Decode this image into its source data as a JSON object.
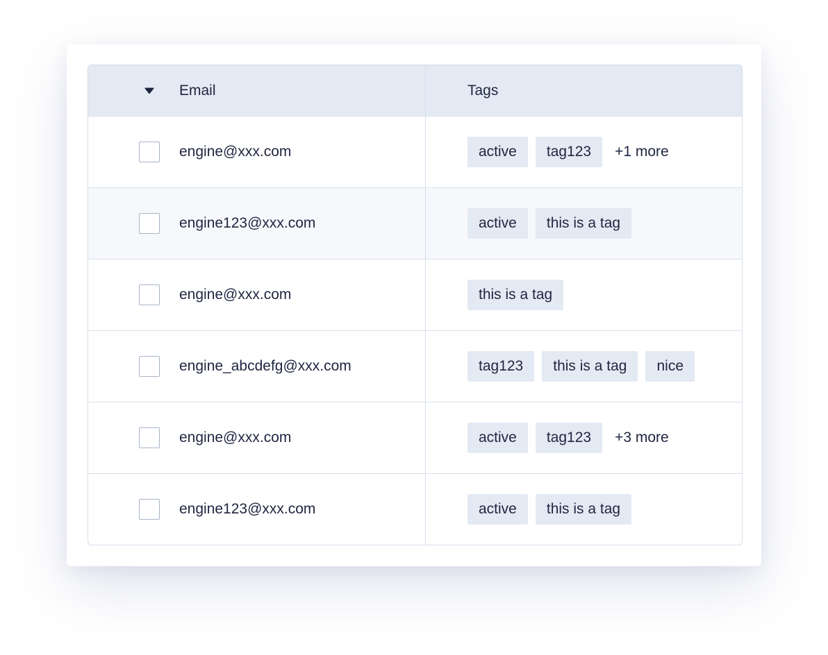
{
  "table": {
    "headers": {
      "email": "Email",
      "tags": "Tags"
    },
    "rows": [
      {
        "email": "engine@xxx.com",
        "tags": [
          "active",
          "tag123"
        ],
        "more": "+1 more"
      },
      {
        "email": "engine123@xxx.com",
        "tags": [
          "active",
          "this is a tag"
        ],
        "more": ""
      },
      {
        "email": "engine@xxx.com",
        "tags": [
          "this is a tag"
        ],
        "more": ""
      },
      {
        "email": "engine_abcdefg@xxx.com",
        "tags": [
          "tag123",
          "this is a tag",
          "nice"
        ],
        "more": ""
      },
      {
        "email": "engine@xxx.com",
        "tags": [
          "active",
          "tag123"
        ],
        "more": "+3 more"
      },
      {
        "email": "engine123@xxx.com",
        "tags": [
          "active",
          "this is a tag"
        ],
        "more": ""
      }
    ]
  },
  "icons": {
    "sort": "caret-down-icon",
    "checkbox": "checkbox-unchecked"
  },
  "colors": {
    "header_bg": "#e4eaf3",
    "tag_bg": "#e4eaf3",
    "text": "#1f2540",
    "border": "#d5deea"
  }
}
